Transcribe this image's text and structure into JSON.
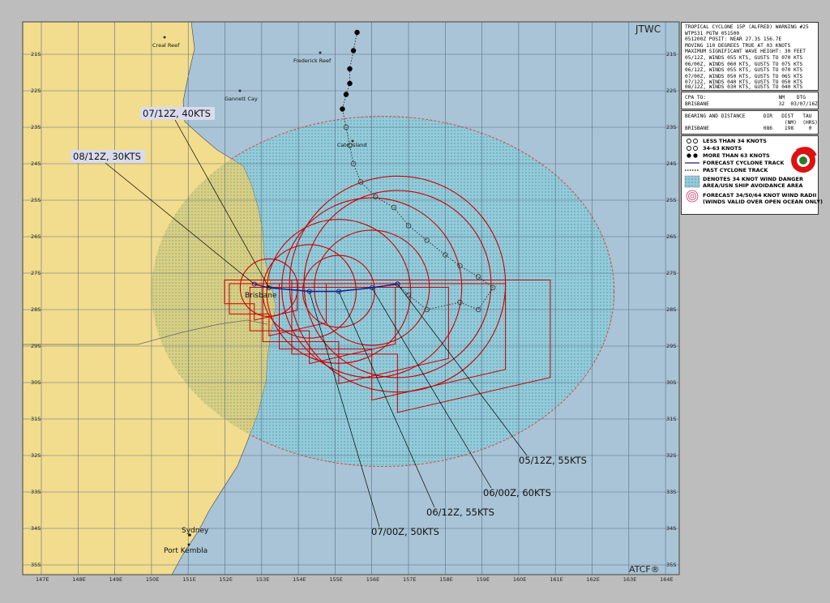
{
  "header": {
    "agency": "JTWC",
    "source": "ATCF®"
  },
  "warning_text": {
    "title": "TROPICAL CYCLONE 15P (ALFRED) WARNING #25",
    "lines": [
      "WTPS31 PGTW 051500",
      "051200Z POSIT: NEAR 27.3S 156.7E",
      "MOVING 110 DEGREES TRUE AT 03 KNOTS",
      "MAXIMUM SIGNIFICANT WAVE HEIGHT: 30 FEET",
      "05/12Z, WINDS 055 KTS, GUSTS TO 070 KTS",
      "06/00Z, WINDS 060 KTS, GUSTS TO 075 KTS",
      "06/12Z, WINDS 055 KTS, GUSTS TO 070 KTS",
      "07/00Z, WINDS 050 KTS, GUSTS TO 065 KTS",
      "07/12Z, WINDS 040 KTS, GUSTS TO 050 KTS",
      "08/12Z, WINDS 030 KTS, GUSTS TO 040 KTS"
    ],
    "cpa_header": "CPA TO:                        NM    DTG",
    "cpa_row": "BRISBANE                       32  03/07/16Z",
    "bd_header": "BEARING AND DISTANCE      DIR   DIST   TAU",
    "bd_units": "                                 (NM)  (HRS)",
    "bd_row": "BRISBANE                  086    198     0"
  },
  "legend": {
    "items": [
      "LESS THAN 34 KNOTS",
      "34-63 KNOTS",
      "MORE THAN 63 KNOTS",
      "FORECAST CYCLONE TRACK",
      "PAST CYCLONE TRACK",
      "DENOTES 34 KNOT WIND DANGER",
      "AREA/USN SHIP AVOIDANCE AREA",
      "FORECAST 34/50/64 KNOT WIND RADII",
      "(WINDS VALID OVER OPEN OCEAN ONLY)"
    ]
  },
  "map": {
    "lon_ticks": [
      "147E",
      "148E",
      "149E",
      "150E",
      "151E",
      "152E",
      "153E",
      "154E",
      "155E",
      "156E",
      "157E",
      "158E",
      "159E",
      "160E",
      "161E",
      "162E",
      "163E",
      "164E"
    ],
    "lat_ticks": [
      "21S",
      "22S",
      "23S",
      "24S",
      "25S",
      "26S",
      "27S",
      "28S",
      "29S",
      "30S",
      "31S",
      "32S",
      "33S",
      "34S",
      "35S"
    ],
    "places": [
      "Creal Reef",
      "Frederick Reef",
      "Gannett Cay",
      "Cato Island",
      "Brisbane",
      "Sydney",
      "Port Kembla"
    ],
    "colors": {
      "ocean": "#a9c4d6",
      "land": "#f2dc8e",
      "danger_area": "#8ecbd8",
      "radii": "#cc0000",
      "grid": "#5a6f88"
    }
  },
  "forecast_labels": [
    {
      "text": "05/12Z,  55KTS",
      "lon": 156.7,
      "lat": -27.3
    },
    {
      "text": "06/00Z,  60KTS",
      "lon": 156.0,
      "lat": -27.4
    },
    {
      "text": "06/12Z,  55KTS",
      "lon": 155.1,
      "lat": -27.5
    },
    {
      "text": "07/00Z,  50KTS",
      "lon": 154.3,
      "lat": -27.5
    },
    {
      "text": "07/12Z,  40KTS",
      "lon": 153.2,
      "lat": -27.4
    },
    {
      "text": "08/12Z,  30KTS",
      "lon": 152.8,
      "lat": -27.3
    }
  ],
  "past_track": [
    {
      "lon": 155.6,
      "lat": -20.4,
      "int": "64"
    },
    {
      "lon": 155.5,
      "lat": -20.9,
      "int": "64"
    },
    {
      "lon": 155.4,
      "lat": -21.4,
      "int": "64"
    },
    {
      "lon": 155.4,
      "lat": -21.8,
      "int": "64"
    },
    {
      "lon": 155.3,
      "lat": -22.1,
      "int": "64"
    },
    {
      "lon": 155.2,
      "lat": -22.5,
      "int": "64"
    },
    {
      "lon": 155.3,
      "lat": -23.0,
      "int": "34"
    },
    {
      "lon": 155.4,
      "lat": -23.5,
      "int": "34"
    },
    {
      "lon": 155.5,
      "lat": -24.0,
      "int": "34"
    },
    {
      "lon": 155.7,
      "lat": -24.5,
      "int": "34"
    },
    {
      "lon": 156.1,
      "lat": -24.9,
      "int": "34"
    },
    {
      "lon": 156.6,
      "lat": -25.2,
      "int": "34"
    },
    {
      "lon": 157.0,
      "lat": -25.7,
      "int": "34"
    },
    {
      "lon": 157.5,
      "lat": -26.1,
      "int": "34"
    },
    {
      "lon": 158.0,
      "lat": -26.5,
      "int": "34"
    },
    {
      "lon": 158.4,
      "lat": -26.8,
      "int": "34"
    },
    {
      "lon": 158.9,
      "lat": -27.1,
      "int": "34"
    },
    {
      "lon": 159.3,
      "lat": -27.4,
      "int": "34"
    },
    {
      "lon": 158.9,
      "lat": -28.0,
      "int": "34"
    },
    {
      "lon": 158.4,
      "lat": -27.8,
      "int": "34"
    },
    {
      "lon": 157.5,
      "lat": -28.0,
      "int": "34"
    },
    {
      "lon": 157.0,
      "lat": -27.6,
      "int": "34"
    },
    {
      "lon": 156.7,
      "lat": -27.3,
      "int": "34"
    }
  ],
  "forecast_track": [
    {
      "lon": 156.7,
      "lat": -27.3
    },
    {
      "lon": 156.0,
      "lat": -27.4
    },
    {
      "lon": 155.1,
      "lat": -27.5
    },
    {
      "lon": 154.3,
      "lat": -27.5
    },
    {
      "lon": 153.2,
      "lat": -27.4
    },
    {
      "lon": 152.8,
      "lat": -27.3
    }
  ],
  "wind_radii_circles": [
    {
      "lon": 156.7,
      "lat": -27.3,
      "r": 2.6
    },
    {
      "lon": 156.7,
      "lat": -27.3,
      "r": 3.0
    },
    {
      "lon": 156.0,
      "lat": -27.4,
      "r": 2.5
    },
    {
      "lon": 156.0,
      "lat": -27.4,
      "r": 1.6
    },
    {
      "lon": 155.1,
      "lat": -27.5,
      "r": 2.0
    },
    {
      "lon": 155.1,
      "lat": -27.5,
      "r": 1.0
    },
    {
      "lon": 154.3,
      "lat": -27.5,
      "r": 1.3
    },
    {
      "lon": 153.2,
      "lat": -27.4,
      "r": 0.8
    }
  ],
  "danger_area": {
    "lon": 156.3,
    "lat": -27.5,
    "rx": 6.3,
    "ry": 4.8
  }
}
